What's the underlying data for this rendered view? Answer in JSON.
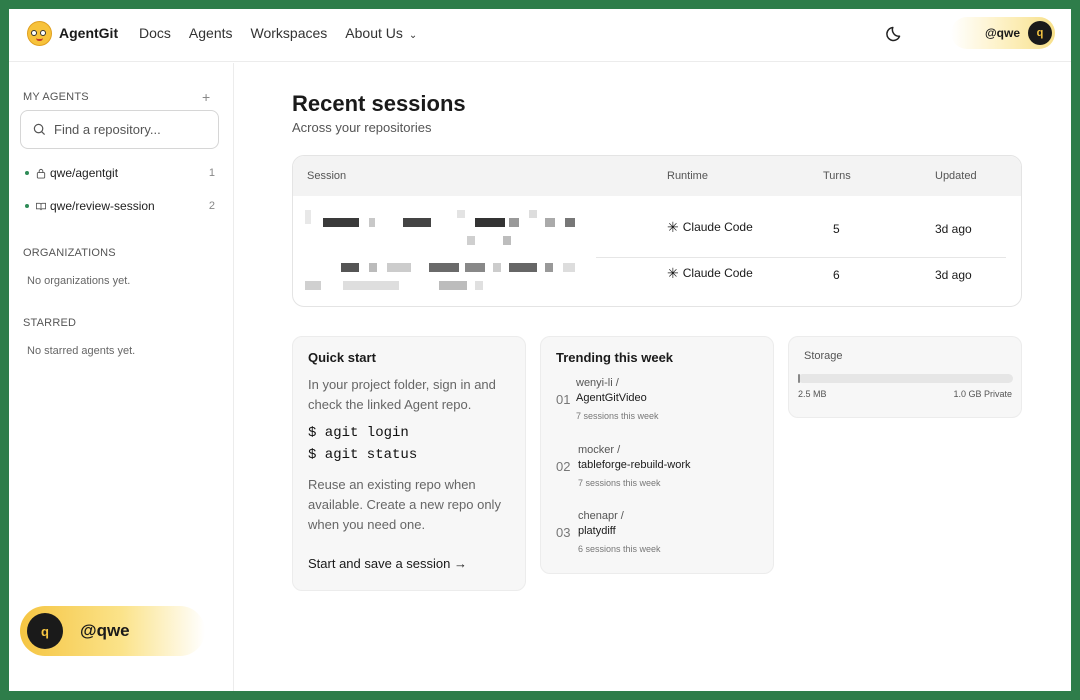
{
  "app": {
    "name": "AgentGit"
  },
  "nav": {
    "items": [
      "Docs",
      "Agents",
      "Workspaces",
      "About Us"
    ]
  },
  "user": {
    "handle": "@qwe",
    "initial": "q"
  },
  "sidebar": {
    "my_agents_title": "MY AGENTS",
    "search_placeholder": "Find a repository...",
    "repos": [
      {
        "name": "qwe/agentgit",
        "count": "1",
        "icon": "lock-icon"
      },
      {
        "name": "qwe/review-session",
        "count": "2",
        "icon": "book-icon"
      }
    ],
    "orgs_title": "ORGANIZATIONS",
    "orgs_empty": "No organizations yet.",
    "starred_title": "STARRED",
    "starred_empty": "No starred agents yet."
  },
  "main": {
    "title": "Recent sessions",
    "subtitle": "Across your repositories",
    "table": {
      "headers": [
        "Session",
        "Runtime",
        "Turns",
        "Updated"
      ],
      "rows": [
        {
          "runtime": "Claude Code",
          "turns": "5",
          "updated": "3d ago"
        },
        {
          "runtime": "Claude Code",
          "turns": "6",
          "updated": "3d ago"
        }
      ]
    }
  },
  "quickstart": {
    "title": "Quick start",
    "intro": "In your project folder, sign in and check the linked Agent repo.",
    "cmd1": "$ agit login",
    "cmd2": "$ agit status",
    "note": "Reuse an existing repo when available. Create a new repo only when you need one.",
    "link": "Start and save a session →"
  },
  "trending": {
    "title": "Trending this week",
    "items": [
      {
        "num": "01",
        "owner": "wenyi-li /",
        "name": "AgentGitVideo",
        "meta": "7 sessions this week"
      },
      {
        "num": "02",
        "owner": "mocker /",
        "name": "tableforge-rebuild-work",
        "meta": "7 sessions this week"
      },
      {
        "num": "03",
        "owner": "chenapr /",
        "name": "platydiff",
        "meta": "6 sessions this week"
      }
    ]
  },
  "storage": {
    "title": "Storage",
    "used": "2.5 MB",
    "total": "1.0 GB Private",
    "fraction": 0.0025
  },
  "colors": {
    "accent": "#f5c542",
    "frame": "#2e7d4a",
    "repo_dot": "#2e8b57"
  }
}
